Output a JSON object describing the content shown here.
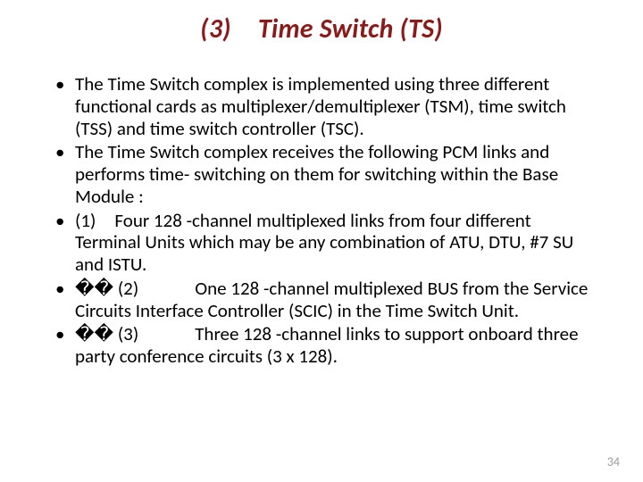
{
  "title": "(3) Time Switch (TS)",
  "bullets": [
    " The Time Switch complex is implemented using three different functional cards as multiplexer/demultiplexer (TSM), time switch (TSS) and time switch controller (TSC).",
    "The Time Switch complex receives the following PCM links and performs time- switching on them for switching within the Base Module :",
    "(1) Four 128 -channel multiplexed links from four different Terminal Units which may be any combination of ATU, DTU, #7 SU and ISTU.",
    "�� (2)   One 128 -channel multiplexed BUS from the Service Circuits Interface Controller (SCIC) in the Time Switch Unit.",
    "�� (3)   Three 128 -channel links to support onboard three party conference circuits (3 x 128)."
  ],
  "page_number": "34"
}
